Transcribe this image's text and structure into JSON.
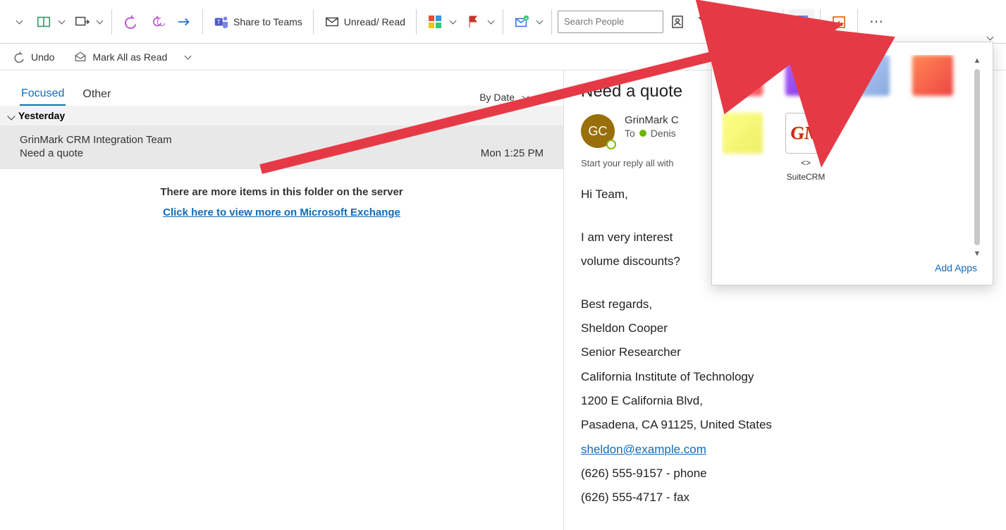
{
  "toolbar": {
    "share_teams": "Share to Teams",
    "unread_read": "Unread/ Read",
    "search_placeholder": "Search People"
  },
  "subbar": {
    "undo": "Undo",
    "mark_all_read": "Mark All as Read"
  },
  "tabs": {
    "focused": "Focused",
    "other": "Other",
    "sort_by": "By Date",
    "sort_indicator": "↑"
  },
  "groups": {
    "yesterday": "Yesterday"
  },
  "messages": [
    {
      "from": "GrinMark CRM Integration Team",
      "subject": "Need a quote",
      "time": "Mon 1:25 PM"
    }
  ],
  "more_items_text": "There are more items in this folder on the server",
  "view_more_link": "Click here to view more on Microsoft Exchange",
  "reading": {
    "subject": "Need a quote",
    "avatar_initials": "GC",
    "from_name": "GrinMark C",
    "to_prefix": "To",
    "to_name": "Denis",
    "reply_hint": "Start your reply all with",
    "body_greeting": "Hi Team,",
    "body_para1": "I am very interest",
    "body_para1_cont": "volume discounts?",
    "sig_regards": "Best regards,",
    "sig_name": "Sheldon Cooper",
    "sig_title": "Senior Researcher",
    "sig_org": "California Institute of Technology",
    "sig_addr1": "1200 E California Blvd,",
    "sig_addr2": "Pasadena, CA 91125, United States",
    "sig_email": "sheldon@example.com",
    "sig_phone": "(626) 555-9157 - phone",
    "sig_fax": "(626) 555-4717 - fax"
  },
  "addins": {
    "suitecrm_line1": "<>",
    "suitecrm_line2": "SuiteCRM",
    "add_apps": "Add Apps"
  }
}
